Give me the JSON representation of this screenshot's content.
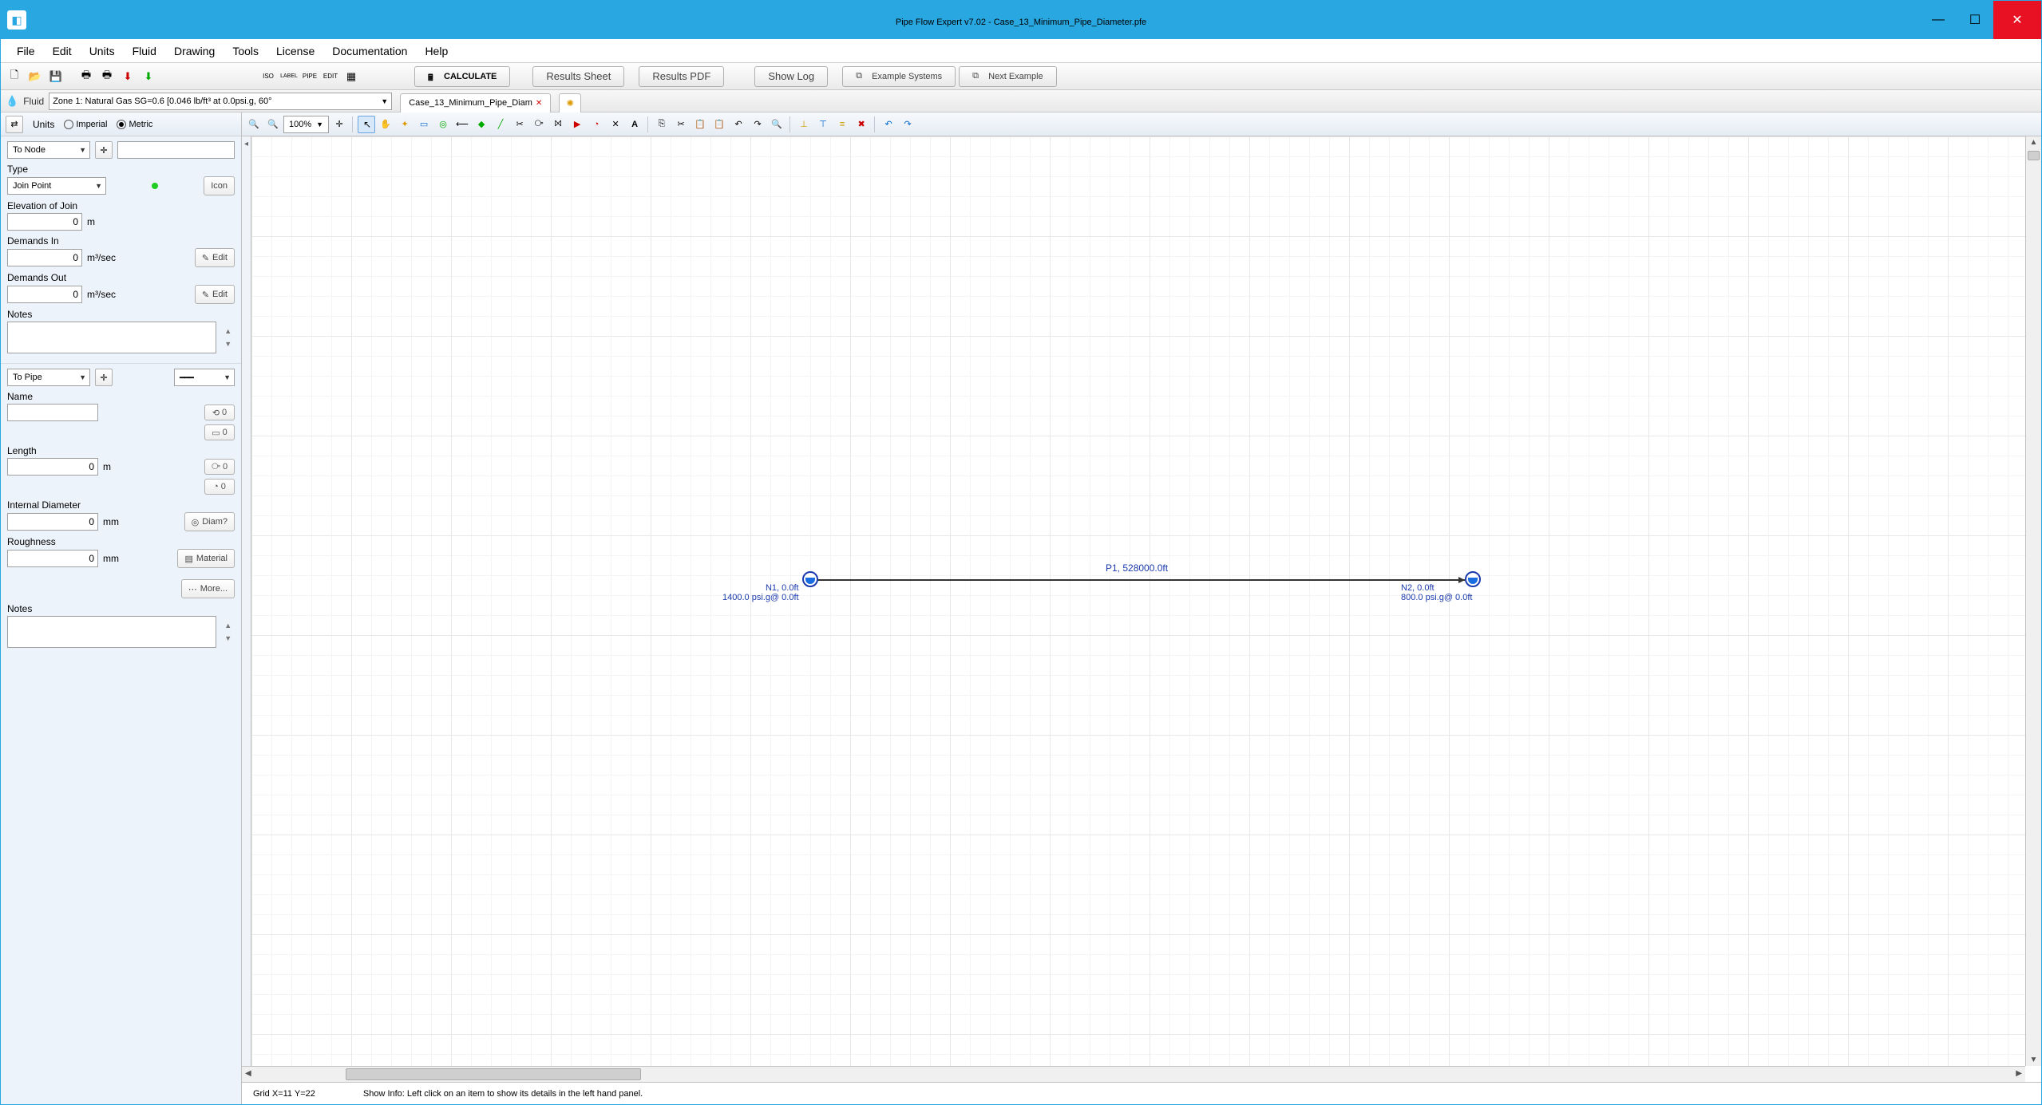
{
  "window": {
    "title_prefix": "Pipe Flow Expert v7.02 - Case_13_",
    "title_emph": "Minimum_Pipe_Diameter",
    "title_suffix": ".pfe"
  },
  "menu": [
    "File",
    "Edit",
    "Units",
    "Fluid",
    "Drawing",
    "Tools",
    "License",
    "Documentation",
    "Help"
  ],
  "toolbar_big": {
    "calculate": "CALCULATE",
    "results_sheet": "Results Sheet",
    "results_pdf": "Results PDF",
    "show_log": "Show Log",
    "example_systems": "Example Systems",
    "next_example": "Next Example"
  },
  "fluid": {
    "label": "Fluid",
    "zone": "Zone 1: Natural Gas SG=0.6 [0.046 lb/ft³ at 0.0psi.g, 60°"
  },
  "doc_tab": "Case_13_Minimum_Pipe_Diam",
  "units": {
    "label": "Units",
    "imperial": "Imperial",
    "metric": "Metric",
    "selected": "Metric"
  },
  "zoom": "100%",
  "node_panel": {
    "selector": "To Node",
    "type_label": "Type",
    "type_value": "Join Point",
    "icon_btn": "Icon",
    "elevation_label": "Elevation of Join",
    "elevation_value": "0",
    "elevation_unit": "m",
    "demands_in_label": "Demands In",
    "demands_in_value": "0",
    "demands_in_unit": "m³/sec",
    "demands_out_label": "Demands Out",
    "demands_out_value": "0",
    "demands_out_unit": "m³/sec",
    "edit": "Edit",
    "notes_label": "Notes"
  },
  "pipe_panel": {
    "selector": "To Pipe",
    "name_label": "Name",
    "name_value": "",
    "length_label": "Length",
    "length_value": "0",
    "length_unit": "m",
    "id_label": "Internal Diameter",
    "id_value": "0",
    "id_unit": "mm",
    "diam_btn": "Diam?",
    "rough_label": "Roughness",
    "rough_value": "0",
    "rough_unit": "mm",
    "material_btn": "Material",
    "more_btn": "More...",
    "notes_label": "Notes",
    "count0": "0"
  },
  "canvas": {
    "n1_line1": "N1, 0.0ft",
    "n1_line2": "1400.0 psi.g@ 0.0ft",
    "n2_line1": "N2, 0.0ft",
    "n2_line2": "800.0 psi.g@ 0.0ft",
    "p1": "P1, 528000.0ft"
  },
  "status": {
    "coords": "Grid  X=11  Y=22",
    "hint": "Show Info: Left click on an item to show its details in the left hand panel."
  }
}
